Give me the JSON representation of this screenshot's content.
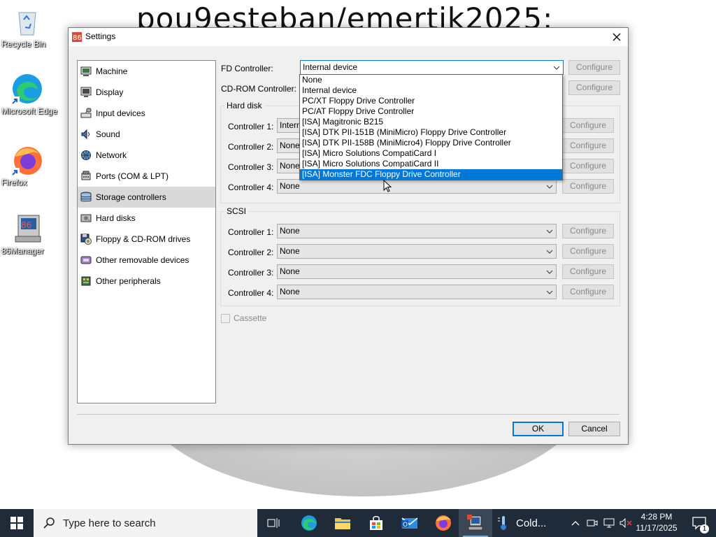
{
  "desktop": {
    "wallpaper_text": "pou9esteban/emertik2025:",
    "icons": [
      {
        "label": "Recycle Bin"
      },
      {
        "label": "Microsoft Edge"
      },
      {
        "label": "Firefox"
      },
      {
        "label": "86Manager"
      }
    ]
  },
  "dialog": {
    "title": "Settings",
    "nav": [
      {
        "label": "Machine",
        "icon": "machine-icon"
      },
      {
        "label": "Display",
        "icon": "display-icon"
      },
      {
        "label": "Input devices",
        "icon": "input-devices-icon"
      },
      {
        "label": "Sound",
        "icon": "sound-icon"
      },
      {
        "label": "Network",
        "icon": "network-icon"
      },
      {
        "label": "Ports (COM & LPT)",
        "icon": "ports-icon"
      },
      {
        "label": "Storage controllers",
        "icon": "storage-controllers-icon",
        "selected": true
      },
      {
        "label": "Hard disks",
        "icon": "hard-disks-icon"
      },
      {
        "label": "Floppy & CD-ROM drives",
        "icon": "floppy-cdrom-icon"
      },
      {
        "label": "Other removable devices",
        "icon": "removable-devices-icon"
      },
      {
        "label": "Other peripherals",
        "icon": "peripherals-icon"
      }
    ],
    "fd": {
      "label": "FD Controller:",
      "value": "Internal device",
      "configure": "Configure"
    },
    "cdrom": {
      "label": "CD-ROM Controller:",
      "configure": "Configure"
    },
    "hard_disk": {
      "title": "Hard disk",
      "rows": [
        {
          "label": "Controller 1:",
          "value": "Internal device",
          "configure": "Configure"
        },
        {
          "label": "Controller 2:",
          "value": "None",
          "configure": "Configure"
        },
        {
          "label": "Controller 3:",
          "value": "None",
          "configure": "Configure"
        },
        {
          "label": "Controller 4:",
          "value": "None",
          "configure": "Configure"
        }
      ]
    },
    "scsi": {
      "title": "SCSI",
      "rows": [
        {
          "label": "Controller 1:",
          "value": "None",
          "configure": "Configure"
        },
        {
          "label": "Controller 2:",
          "value": "None",
          "configure": "Configure"
        },
        {
          "label": "Controller 3:",
          "value": "None",
          "configure": "Configure"
        },
        {
          "label": "Controller 4:",
          "value": "None",
          "configure": "Configure"
        }
      ]
    },
    "cassette": {
      "label": "Cassette",
      "checked": false
    },
    "dropdown_options": [
      "None",
      "Internal device",
      "PC/XT Floppy Drive Controller",
      "PC/AT Floppy Drive Controller",
      "[ISA] Magitronic B215",
      "[ISA] DTK PII-151B (MiniMicro) Floppy Drive Controller",
      "[ISA] DTK PII-158B (MiniMicro4) Floppy Drive Controller",
      "[ISA] Micro Solutions CompatiCard I",
      "[ISA] Micro Solutions CompatiCard II",
      "[ISA] Monster FDC Floppy Drive Controller"
    ],
    "dropdown_highlighted": "[ISA] Monster FDC Floppy Drive Controller",
    "ok": "OK",
    "cancel": "Cancel"
  },
  "taskbar": {
    "search_placeholder": "Type here to search",
    "weather": "Cold...",
    "time": "4:28 PM",
    "date": "11/17/2025",
    "notification_count": "1"
  },
  "colors": {
    "accent": "#0078d7",
    "taskbar": "#1f2b38"
  }
}
